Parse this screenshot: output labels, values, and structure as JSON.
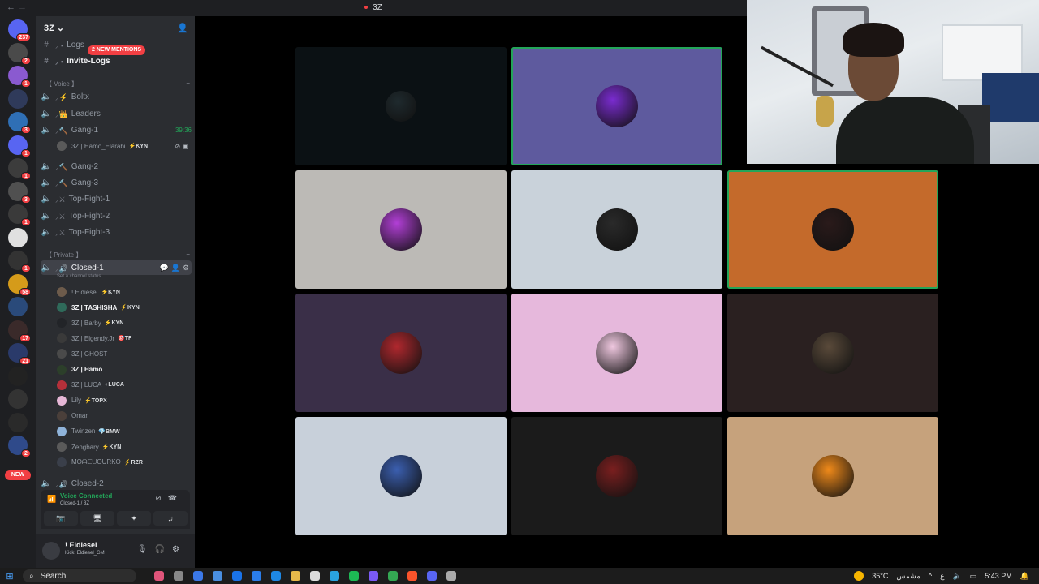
{
  "titlebar": {
    "title": "3Z"
  },
  "guild_badges": [
    "237",
    "2",
    "1",
    "",
    "3",
    "1",
    "1",
    "3",
    "1",
    "",
    "1",
    "58",
    "",
    "17",
    "21",
    "",
    "",
    "",
    "2"
  ],
  "guild_new_label": "NEW",
  "server": {
    "name": "3Z ⌄",
    "mention_pill": "2 NEW MENTIONS"
  },
  "channels": {
    "logs": "Logs",
    "invite_logs": "Invite-Logs",
    "voice_category": "【 Voice 】",
    "boltx": "Boltx",
    "leaders": "Leaders",
    "gang1": "Gang-1",
    "gang1_timer": "39:36",
    "gang1_member": "3Z | Hamo_Elarabi",
    "gang1_member_tag": "⚡KYN",
    "gang2": "Gang-2",
    "gang3": "Gang-3",
    "topfight1": "Top-Fight-1",
    "topfight2": "Top-Fight-2",
    "topfight3": "Top-Fight-3",
    "private_category": "【 Private 】",
    "closed1": "Closed-1",
    "closed1_status": "Set a channel status",
    "closed2": "Closed-2"
  },
  "members": [
    {
      "name": "! Eldiesel",
      "tag": "⚡KYN",
      "color": "#6d5b4b"
    },
    {
      "name": "3Z | TASHISHA",
      "tag": "⚡KYN",
      "color": "#2f6a5a"
    },
    {
      "name": "3Z | Barby",
      "tag": "⚡KYN",
      "color": "#222428"
    },
    {
      "name": "3Z | Elgendy.Jr",
      "tag": "🎯TF",
      "color": "#3a3a3a"
    },
    {
      "name": "3Z | GHOST",
      "tag": "",
      "color": "#4a4a4a"
    },
    {
      "name": "3Z | Hamo",
      "tag": "",
      "color": "#2c3f2a"
    },
    {
      "name": "3Z | LUCA",
      "tag": "◐LUCA",
      "color": "#b5303a"
    },
    {
      "name": "Lily",
      "tag": "⚡TOPX",
      "color": "#e6b7d6"
    },
    {
      "name": "Omar",
      "tag": "",
      "color": "#4a3f3a"
    },
    {
      "name": "Twinzen",
      "tag": "💎BMW",
      "color": "#8fb3d9"
    },
    {
      "name": "Zengbary",
      "tag": "⚡KYN",
      "color": "#5a5a5a"
    },
    {
      "name": "MOᗩᑕᑌOURKO",
      "tag": "⚡RZR",
      "color": "#3a3f4a"
    }
  ],
  "voice": {
    "title": "Voice Connected",
    "subtitle": "Closed-1 / 3Z"
  },
  "user": {
    "name": "! Eldiesel",
    "status": "Kick: Eldiesel_GM"
  },
  "taskbar": {
    "search": "Search",
    "weather": "35°C",
    "weather_label": "مشمس",
    "lang": "ع",
    "time": "5:43 PM"
  },
  "tiles_colors": [
    "#0b1114",
    "#5e5a9e",
    "#bcbab6",
    "#c9d2da",
    "#c46a2b",
    "#3a2f48",
    "#e6b8dc",
    "#2a2020",
    "#c8d0da",
    "#1b1b1b",
    "#c6a27c"
  ]
}
